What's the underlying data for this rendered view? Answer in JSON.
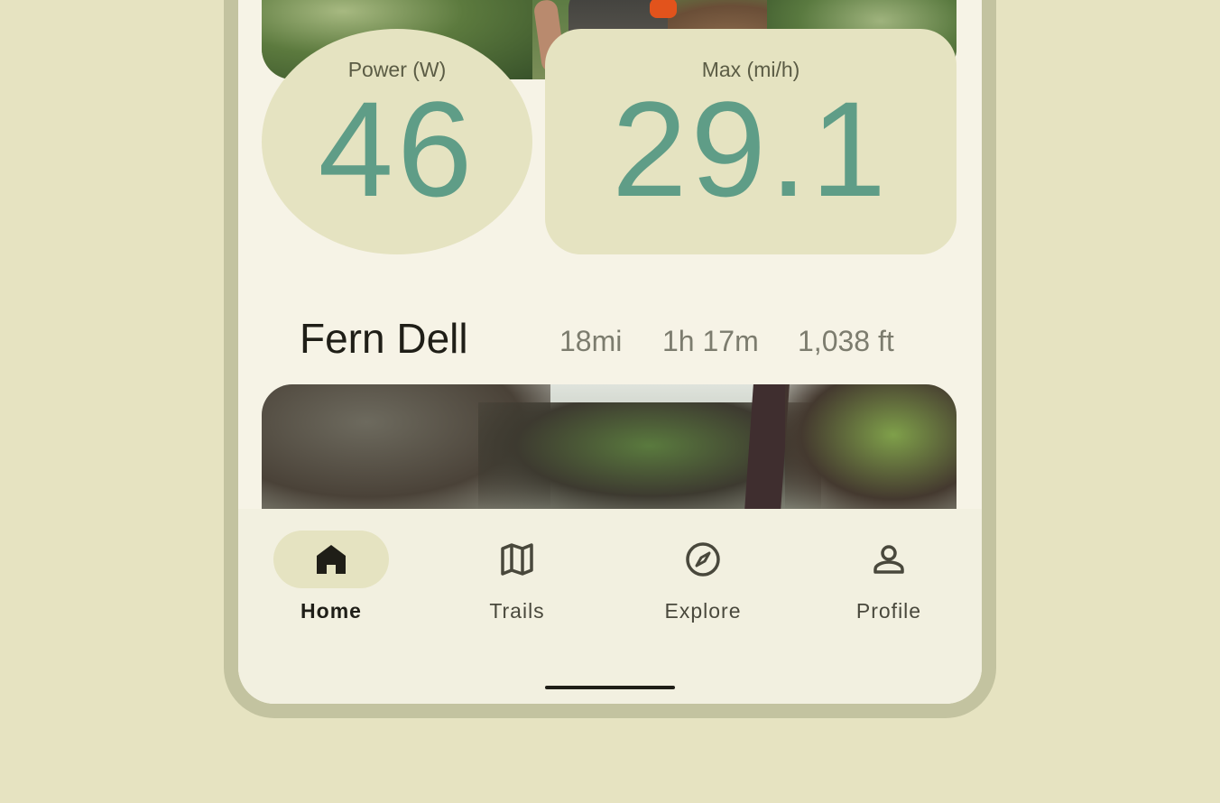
{
  "stats": {
    "power": {
      "label": "Power (W)",
      "value": "46"
    },
    "max_speed": {
      "label": "Max (mi/h)",
      "value": "29.1"
    }
  },
  "trail": {
    "name": "Fern Dell",
    "distance": "18mi",
    "duration": "1h 17m",
    "elevation": "1,038 ft"
  },
  "bottom_nav": {
    "items": [
      {
        "label": "Home",
        "icon": "home-icon",
        "active": true
      },
      {
        "label": "Trails",
        "icon": "map-icon",
        "active": false
      },
      {
        "label": "Explore",
        "icon": "compass-icon",
        "active": false
      },
      {
        "label": "Profile",
        "icon": "person-icon",
        "active": false
      }
    ]
  },
  "colors": {
    "background": "#e6e3c1",
    "surface": "#f6f3e6",
    "accent_container": "#e5e3c1",
    "stat_value": "#5f9d87",
    "frame": "#c3c3a0"
  }
}
